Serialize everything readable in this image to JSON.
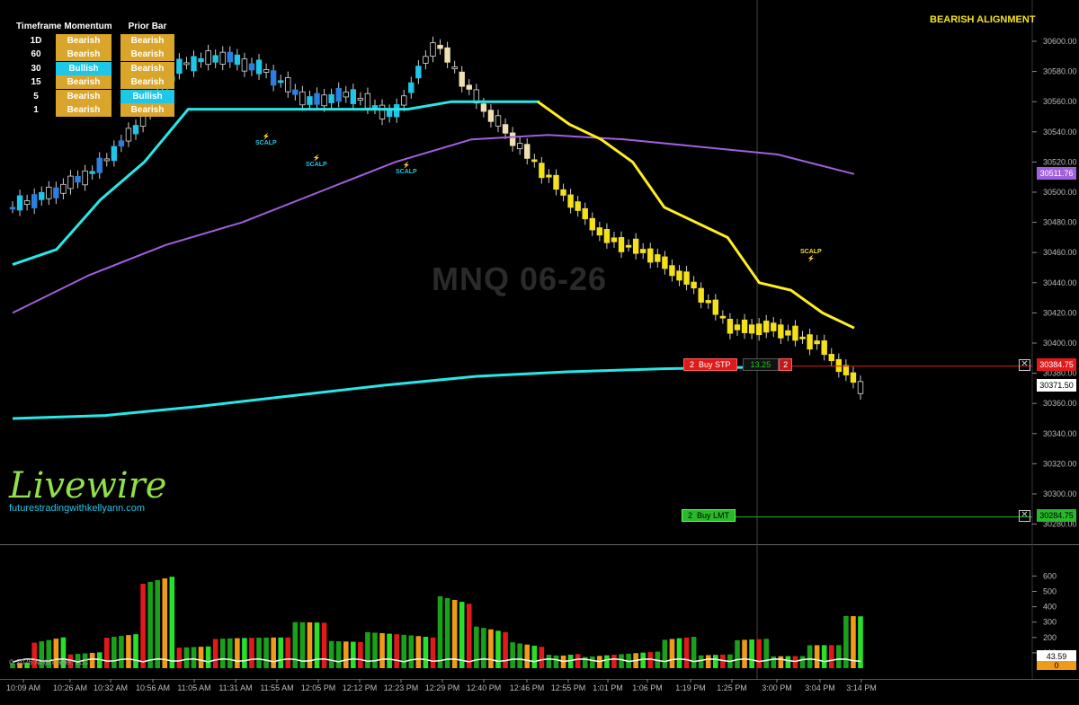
{
  "alignment_table": {
    "headers": [
      "Timeframe",
      "Momentum",
      "Prior Bar"
    ],
    "rows": [
      {
        "tf": "1D",
        "momentum": "Bearish",
        "prior": "Bearish"
      },
      {
        "tf": "60",
        "momentum": "Bearish",
        "prior": "Bearish"
      },
      {
        "tf": "30",
        "momentum": "Bullish",
        "prior": "Bearish"
      },
      {
        "tf": "15",
        "momentum": "Bearish",
        "prior": "Bearish"
      },
      {
        "tf": "5",
        "momentum": "Bearish",
        "prior": "Bullish"
      },
      {
        "tf": "1",
        "momentum": "Bearish",
        "prior": "Bearish"
      }
    ]
  },
  "alignment_status": "BEARISH ALIGNMENT",
  "instrument": "MNQ 06-26",
  "brand": {
    "name": "Livewire",
    "site": "futurestradingwithkellyann.com"
  },
  "copyright": "© 2026 NinjaTrader, LLC",
  "scalp_label": "SCALP",
  "orders": {
    "buy_stop": {
      "qty": "2",
      "label": "Buy STP",
      "offset": "13.25",
      "count": "2",
      "price": "30384.75"
    },
    "buy_limit": {
      "qty": "2",
      "label": "Buy LMT",
      "price": "30284.75"
    },
    "close_icon": "✕"
  },
  "price_axis": {
    "ticks": [
      "30600.00",
      "30580.00",
      "30560.00",
      "30540.00",
      "30520.00",
      "30500.00",
      "30480.00",
      "30460.00",
      "30440.00",
      "30420.00",
      "30400.00",
      "30380.00",
      "30360.00",
      "30340.00",
      "30320.00",
      "30300.00",
      "30280.00"
    ],
    "min": 30270,
    "max": 30606,
    "last_price": "30371.50",
    "ma_price": "30511.76"
  },
  "volume_axis": {
    "ticks": [
      "600",
      "500",
      "400",
      "300",
      "200",
      "100"
    ],
    "max": 690,
    "value_tag": "43.59",
    "zero_tag": "0"
  },
  "time_axis": [
    "10:09 AM",
    "10:26 AM",
    "10:32 AM",
    "10:56 AM",
    "11:05 AM",
    "11:31 AM",
    "11:55 AM",
    "12:05 PM",
    "12:12 PM",
    "12:23 PM",
    "12:29 PM",
    "12:40 PM",
    "12:46 PM",
    "12:55 PM",
    "1:01 PM",
    "1:06 PM",
    "1:19 PM",
    "1:25 PM",
    "3:00 PM",
    "3:04 PM",
    "3:14 PM"
  ],
  "colors": {
    "bull_bar": "#1ec6e8",
    "bull_bar_dark": "#2a7fe0",
    "bear_bar": "#f5e11a",
    "bear_bar_pale": "#f0e0b0",
    "trail_cyan": "#27e8e8",
    "trail_yellow": "#ffee22",
    "ma_purple": "#a060e0",
    "vol_green": "#1aa01a",
    "vol_bright_green": "#28e028",
    "vol_red": "#e01a1a",
    "vol_orange": "#f09a1a",
    "order_red": "#e01a1a",
    "order_green": "#28b828"
  },
  "chart_data": {
    "type": "candlestick",
    "x": [
      "10:09 AM",
      "10:26 AM",
      "10:32 AM",
      "10:56 AM",
      "11:05 AM",
      "11:31 AM",
      "11:55 AM",
      "12:05 PM",
      "12:12 PM",
      "12:23 PM",
      "12:29 PM",
      "12:40 PM",
      "12:46 PM",
      "12:55 PM",
      "1:01 PM",
      "1:06 PM",
      "1:19 PM",
      "1:25 PM",
      "3:00 PM",
      "3:04 PM",
      "3:14 PM"
    ],
    "close": [
      30490,
      30500,
      30515,
      30545,
      30585,
      30590,
      30580,
      30560,
      30565,
      30550,
      30600,
      30560,
      30530,
      30500,
      30470,
      30460,
      30440,
      30410,
      30410,
      30400,
      30371.5
    ],
    "cyan_trail": [
      30452,
      30462,
      30495,
      30520,
      30555,
      30555,
      30555,
      30555,
      30555,
      30555,
      30560,
      30560,
      30560
    ],
    "yellow_trail": [
      30560,
      30545,
      30535,
      30520,
      30490,
      30480,
      30470,
      30440,
      30435,
      30420,
      30410
    ],
    "purple_ma": [
      30420,
      30445,
      30465,
      30480,
      30500,
      30520,
      30535,
      30538,
      30535,
      30530,
      30525,
      30512
    ],
    "volume": [
      80,
      350,
      150,
      280,
      680,
      150,
      200,
      200,
      300,
      180,
      250,
      250,
      600,
      400,
      300,
      200,
      150,
      150,
      250,
      100,
      200,
      80,
      150,
      340
    ],
    "xlabel": "",
    "ylabel": "",
    "ylim": [
      30270,
      30606
    ]
  }
}
